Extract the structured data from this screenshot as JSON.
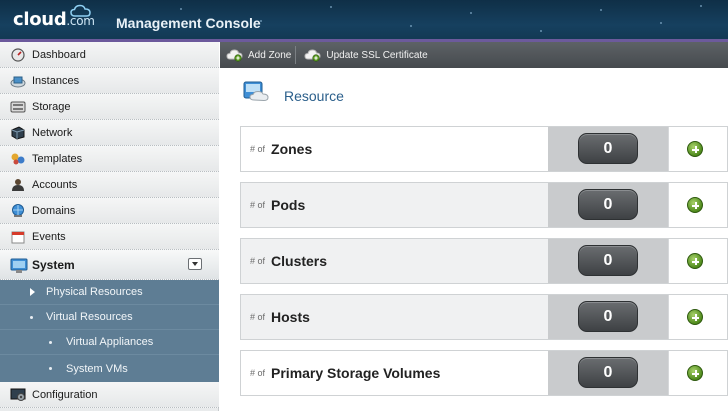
{
  "header": {
    "logo_text": "cloud",
    "logo_suffix": ".com",
    "title": "Management Console"
  },
  "sidebar": {
    "items": [
      {
        "label": "Dashboard",
        "icon": "dashboard-icon"
      },
      {
        "label": "Instances",
        "icon": "instances-icon"
      },
      {
        "label": "Storage",
        "icon": "storage-icon"
      },
      {
        "label": "Network",
        "icon": "network-icon"
      },
      {
        "label": "Templates",
        "icon": "templates-icon"
      },
      {
        "label": "Accounts",
        "icon": "accounts-icon"
      },
      {
        "label": "Domains",
        "icon": "domains-icon"
      },
      {
        "label": "Events",
        "icon": "events-icon"
      },
      {
        "label": "System",
        "icon": "system-icon",
        "selected": true
      },
      {
        "label": "Configuration",
        "icon": "configuration-icon"
      }
    ],
    "system_children": [
      {
        "label": "Physical Resources"
      },
      {
        "label": "Virtual Resources"
      },
      {
        "label": "Virtual Appliances"
      },
      {
        "label": "System VMs"
      }
    ]
  },
  "toolbar": {
    "add_zone_label": "Add Zone",
    "update_ssl_label": "Update SSL Certificate"
  },
  "main": {
    "section_title": "Resource",
    "count_prefix": "# of",
    "resources": [
      {
        "name": "Zones",
        "count": "0"
      },
      {
        "name": "Pods",
        "count": "0"
      },
      {
        "name": "Clusters",
        "count": "0"
      },
      {
        "name": "Hosts",
        "count": "0"
      },
      {
        "name": "Primary Storage Volumes",
        "count": "0"
      }
    ]
  },
  "colors": {
    "header_bg": "#16405f",
    "toolbar_bg": "#4f5458",
    "subnav_bg": "#5e7d94",
    "accent_blue": "#2b5f8b",
    "add_green": "#4f8a1c"
  }
}
